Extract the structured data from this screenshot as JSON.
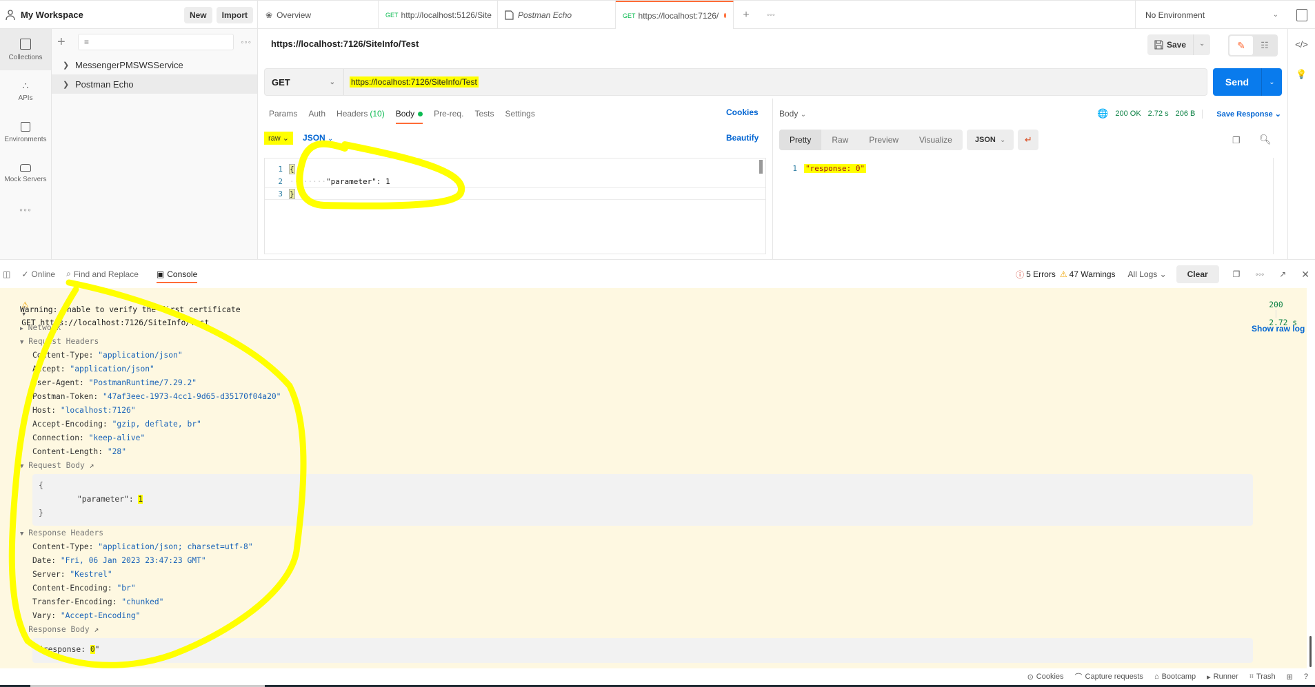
{
  "workspace": {
    "title": "My Workspace",
    "new_label": "New",
    "import_label": "Import"
  },
  "tabs": [
    {
      "label": "Overview",
      "icon": "binoculars-icon"
    },
    {
      "method": "GET",
      "label": "http://localhost:5126/Site"
    },
    {
      "label": "Postman Echo",
      "icon": "collection-icon"
    },
    {
      "method": "GET",
      "label": "https://localhost:7126/",
      "unsaved": true,
      "active": true
    }
  ],
  "environment": {
    "selected": "No Environment"
  },
  "rail": [
    {
      "label": "Collections",
      "icon": "collections-icon",
      "active": true
    },
    {
      "label": "APIs",
      "icon": "apis-icon"
    },
    {
      "label": "Environments",
      "icon": "environments-icon"
    },
    {
      "label": "Mock Servers",
      "icon": "mock-servers-icon"
    }
  ],
  "collections": [
    {
      "name": "MessengerPMSWSService"
    },
    {
      "name": "Postman Echo"
    }
  ],
  "request": {
    "title": "https://localhost:7126/SiteInfo/Test",
    "save_label": "Save",
    "method": "GET",
    "url": "https://localhost:7126/SiteInfo/Test",
    "send_label": "Send",
    "tabs": {
      "params": "Params",
      "auth": "Auth",
      "headers": "Headers",
      "headers_count": "(10)",
      "body": "Body",
      "prereq": "Pre-req.",
      "tests": "Tests",
      "settings": "Settings"
    },
    "cookies_label": "Cookies",
    "body_mode": "raw",
    "body_format": "JSON",
    "beautify_label": "Beautify",
    "editor_lines": [
      {
        "n": "1",
        "text": "{"
      },
      {
        "n": "2",
        "key": "\"parameter\"",
        "value": "1"
      },
      {
        "n": "3",
        "text": "}"
      }
    ]
  },
  "response": {
    "body_label": "Body",
    "status": "200 OK",
    "time": "2.72 s",
    "size": "206 B",
    "save_response_label": "Save Response",
    "view_tabs": [
      "Pretty",
      "Raw",
      "Preview",
      "Visualize"
    ],
    "format": "JSON",
    "lines": [
      {
        "n": "1",
        "text": "\"response: 0\""
      }
    ]
  },
  "console_bar": {
    "online": "Online",
    "find_replace": "Find and Replace",
    "console": "Console",
    "errors": "5 Errors",
    "warnings": "47 Warnings",
    "log_filter": "All Logs",
    "clear": "Clear"
  },
  "console": {
    "request_line": "GET https://localhost:7126/SiteInfo/Test",
    "status_code": "200",
    "elapsed": "2.72 s",
    "warning": "Warning: Unable to verify the first certificate",
    "show_raw_log": "Show raw log",
    "network_label": "Network",
    "request_headers_label": "Request Headers",
    "request_headers": [
      {
        "k": "Content-Type: ",
        "v": "\"application/json\""
      },
      {
        "k": "Accept: ",
        "v": "\"application/json\""
      },
      {
        "k": "User-Agent: ",
        "v": "\"PostmanRuntime/7.29.2\""
      },
      {
        "k": "Postman-Token: ",
        "v": "\"47af3eec-1973-4cc1-9d65-d35170f04a20\""
      },
      {
        "k": "Host: ",
        "v": "\"localhost:7126\""
      },
      {
        "k": "Accept-Encoding: ",
        "v": "\"gzip, deflate, br\""
      },
      {
        "k": "Connection: ",
        "v": "\"keep-alive\""
      },
      {
        "k": "Content-Length: ",
        "v": "\"28\""
      }
    ],
    "request_body_label": "Request Body",
    "request_body": {
      "open": "{",
      "key": "\"parameter\": ",
      "value": "1",
      "close": "}"
    },
    "response_headers_label": "Response Headers",
    "response_headers": [
      {
        "k": "Content-Type: ",
        "v": "\"application/json; charset=utf-8\""
      },
      {
        "k": "Date: ",
        "v": "\"Fri, 06 Jan 2023 23:47:23 GMT\""
      },
      {
        "k": "Server: ",
        "v": "\"Kestrel\""
      },
      {
        "k": "Content-Encoding: ",
        "v": "\"br\""
      },
      {
        "k": "Transfer-Encoding: ",
        "v": "\"chunked\""
      },
      {
        "k": "Vary: ",
        "v": "\"Accept-Encoding\""
      }
    ],
    "response_body_label": "Response Body",
    "response_body": {
      "prefix": "\"response: ",
      "value": "0",
      "suffix": "\""
    }
  },
  "statusbar": {
    "cookies": "Cookies",
    "capture": "Capture requests",
    "bootcamp": "Bootcamp",
    "runner": "Runner",
    "trash": "Trash"
  },
  "colors": {
    "accent": "#ff6c37",
    "primary": "#097bed",
    "success": "#0cbb52",
    "link": "#0265d2",
    "highlight": "#ffff00",
    "console_bg": "#fef8e1"
  }
}
